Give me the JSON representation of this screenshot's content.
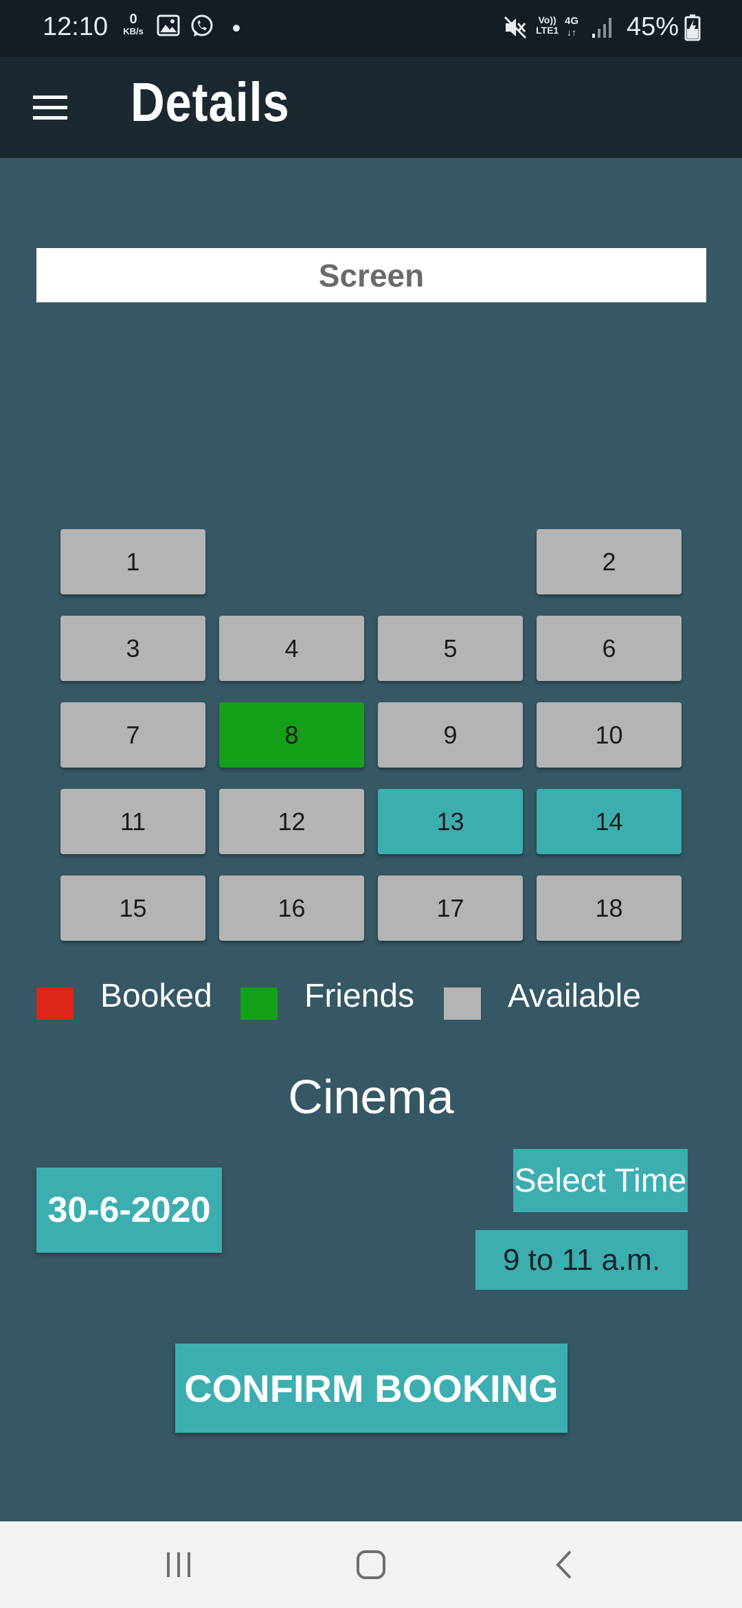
{
  "status_bar": {
    "time": "12:10",
    "net_speed_value": "0",
    "net_speed_unit": "KB/s",
    "volte": "Vo))",
    "lte": "LTE1",
    "network": "4G",
    "battery": "45%"
  },
  "app_bar": {
    "title": "Details"
  },
  "screen_label": "Screen",
  "seats": [
    {
      "number": "1",
      "state": "available"
    },
    {
      "number": "2",
      "state": "available"
    },
    {
      "number": "3",
      "state": "available"
    },
    {
      "number": "4",
      "state": "available"
    },
    {
      "number": "5",
      "state": "available"
    },
    {
      "number": "6",
      "state": "available"
    },
    {
      "number": "7",
      "state": "available"
    },
    {
      "number": "8",
      "state": "friends"
    },
    {
      "number": "9",
      "state": "available"
    },
    {
      "number": "10",
      "state": "available"
    },
    {
      "number": "11",
      "state": "available"
    },
    {
      "number": "12",
      "state": "available"
    },
    {
      "number": "13",
      "state": "selected"
    },
    {
      "number": "14",
      "state": "selected"
    },
    {
      "number": "15",
      "state": "available"
    },
    {
      "number": "16",
      "state": "available"
    },
    {
      "number": "17",
      "state": "available"
    },
    {
      "number": "18",
      "state": "available"
    }
  ],
  "legend": [
    {
      "label": "Booked",
      "color": "#dd2418"
    },
    {
      "label": "Friends",
      "color": "#14a018"
    },
    {
      "label": "Available",
      "color": "#b4b4b4"
    }
  ],
  "cinema_label": "Cinema",
  "date": "30-6-2020",
  "select_time_label": "Select Time",
  "selected_time": "9 to 11 a.m.",
  "confirm_label": "CONFIRM BOOKING",
  "colors": {
    "background": "#365764",
    "app_bar": "#1c2830",
    "status_bar": "#151c22",
    "accent": "#3daeb0",
    "seat_available": "#b4b4b4",
    "seat_friends": "#14a018",
    "seat_selected": "#3daeb0"
  },
  "nav_bar": {
    "items": [
      "recents-icon",
      "home-icon",
      "back-icon"
    ]
  }
}
